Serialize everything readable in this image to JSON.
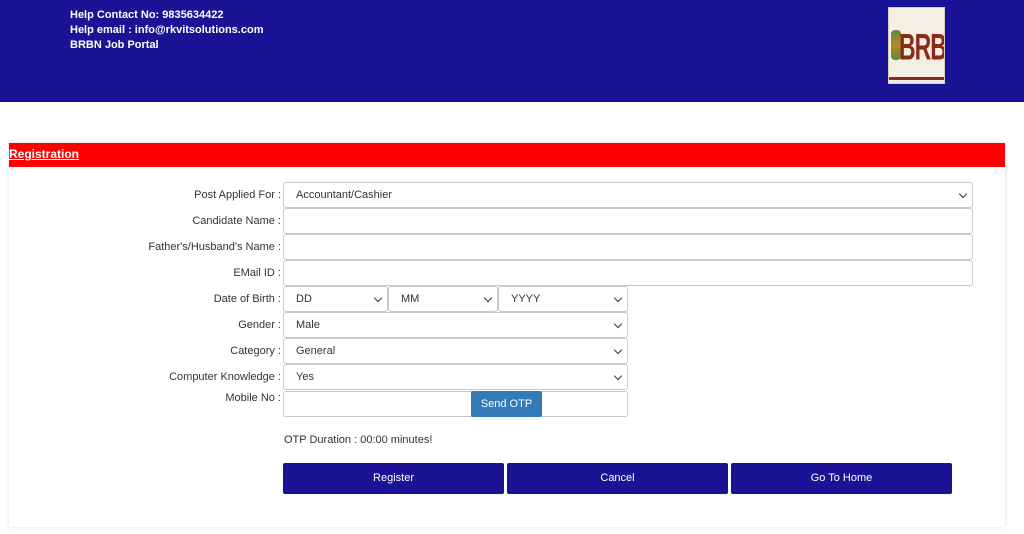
{
  "header": {
    "help_contact": "Help   Contact No: 9835634422",
    "help_email": "Help   email : info@rkvitsolutions.com",
    "portal_name": "BRBN Job Portal",
    "logo_text": "BRBN"
  },
  "form": {
    "title": "Registration",
    "post_label": "Post Applied For :",
    "post_value": "Accountant/Cashier",
    "candidate_label": "Candidate Name :",
    "father_label": "Father's/Husband's Name :",
    "email_label": "EMail ID :",
    "dob_label": "Date of Birth :",
    "dob_day": "DD",
    "dob_month": "MM",
    "dob_year": "YYYY",
    "gender_label": "Gender :",
    "gender_value": "Male",
    "category_label": "Category :",
    "category_value": "General",
    "computer_label": "Computer Knowledge :",
    "computer_value": "Yes",
    "mobile_label": "Mobile No :",
    "send_otp": "Send OTP",
    "otp_duration": "OTP Duration : 00:00 minutes!",
    "register": "Register",
    "cancel": "Cancel",
    "go_home": "Go To Home"
  },
  "colors": {
    "header_bg": "#1b1396",
    "panel_title_bg": "#ff0000",
    "otp_button": "#337ab7",
    "action_button": "#1b1396"
  }
}
